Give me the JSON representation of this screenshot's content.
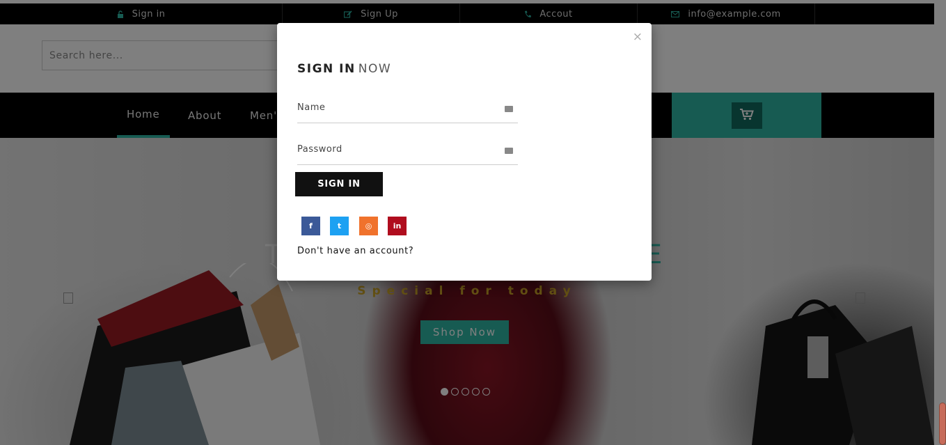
{
  "topbar": {
    "items": [
      {
        "icon": "lock-icon",
        "label": "Sign in"
      },
      {
        "icon": "edit-icon",
        "label": "Sign Up"
      },
      {
        "icon": "phone-icon",
        "label": "Accout"
      },
      {
        "icon": "envelope-icon",
        "label": "info@example.com"
      }
    ]
  },
  "header": {
    "search": {
      "placeholder": "Search here..."
    }
  },
  "nav": {
    "items": [
      "Home",
      "About",
      "Men'"
    ],
    "active": "Home"
  },
  "hero": {
    "title_fragment": "T",
    "title_fragment_right": "E",
    "subtitle": "Special for today",
    "button": "Shop Now",
    "slide_count": 5,
    "active_slide": 1
  },
  "modal": {
    "title_bold": "SIGN IN",
    "title_light": "NOW",
    "close": "×",
    "name_placeholder": "Name",
    "password_placeholder": "Password",
    "submit": "SIGN IN",
    "social": [
      {
        "icon": "facebook-icon",
        "glyph": "f",
        "color": "#3b5998"
      },
      {
        "icon": "twitter-icon",
        "glyph": "t",
        "color": "#1da1f2"
      },
      {
        "icon": "instagram-icon",
        "glyph": "◎",
        "color": "#f0722c"
      },
      {
        "icon": "linkedin-icon",
        "glyph": "in",
        "color": "#b00d1e"
      }
    ],
    "footer_text": "Don't have an account?"
  },
  "colors": {
    "accent": "#2fb7a5",
    "topbar": "#000000",
    "hero_subtitle": "#c9a227"
  }
}
